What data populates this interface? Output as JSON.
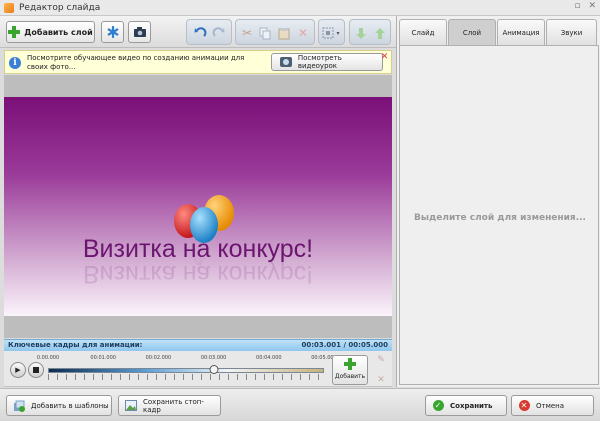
{
  "window": {
    "title": "Редактор слайда",
    "controls": [
      "▫",
      "✕"
    ]
  },
  "toolbar": {
    "add_layer_label": "Добавить слой",
    "icons": [
      "asterisk-icon",
      "camera-icon",
      "undo-icon",
      "redo-icon",
      "cut-icon",
      "copy-icon",
      "paste-icon",
      "delete-icon",
      "align-icon",
      "move-down-icon",
      "move-up-icon"
    ]
  },
  "infobar": {
    "text": "Посмотрите обучающее видео по созданию анимации для своих фото...",
    "button_label": "Посмотреть видеоурок"
  },
  "slide": {
    "title_text": "Визитка на конкурс!",
    "balloon_colors": [
      "#e8312a",
      "#f5a623",
      "#3aa7e0"
    ]
  },
  "keyframes": {
    "label": "Ключевые кадры для анимации:",
    "time_display": "00:03.001 / 00:05.000",
    "tick_labels": [
      "0.00.000",
      "00:01.000",
      "00:02.000",
      "00:03.000",
      "00:04.000",
      "00:05.000"
    ],
    "position_fraction": 0.6,
    "add_label": "Добавить"
  },
  "right_panel": {
    "tabs": [
      "Слайд",
      "Слой",
      "Анимация",
      "Звуки"
    ],
    "active_tab": "Слой",
    "hint": "Выделите слой для изменения..."
  },
  "bottom": {
    "add_to_templates_label": "Добавить в шаблоны",
    "save_frame_label": "Сохранить стоп-кадр",
    "save_label": "Сохранить",
    "cancel_label": "Отмена"
  }
}
